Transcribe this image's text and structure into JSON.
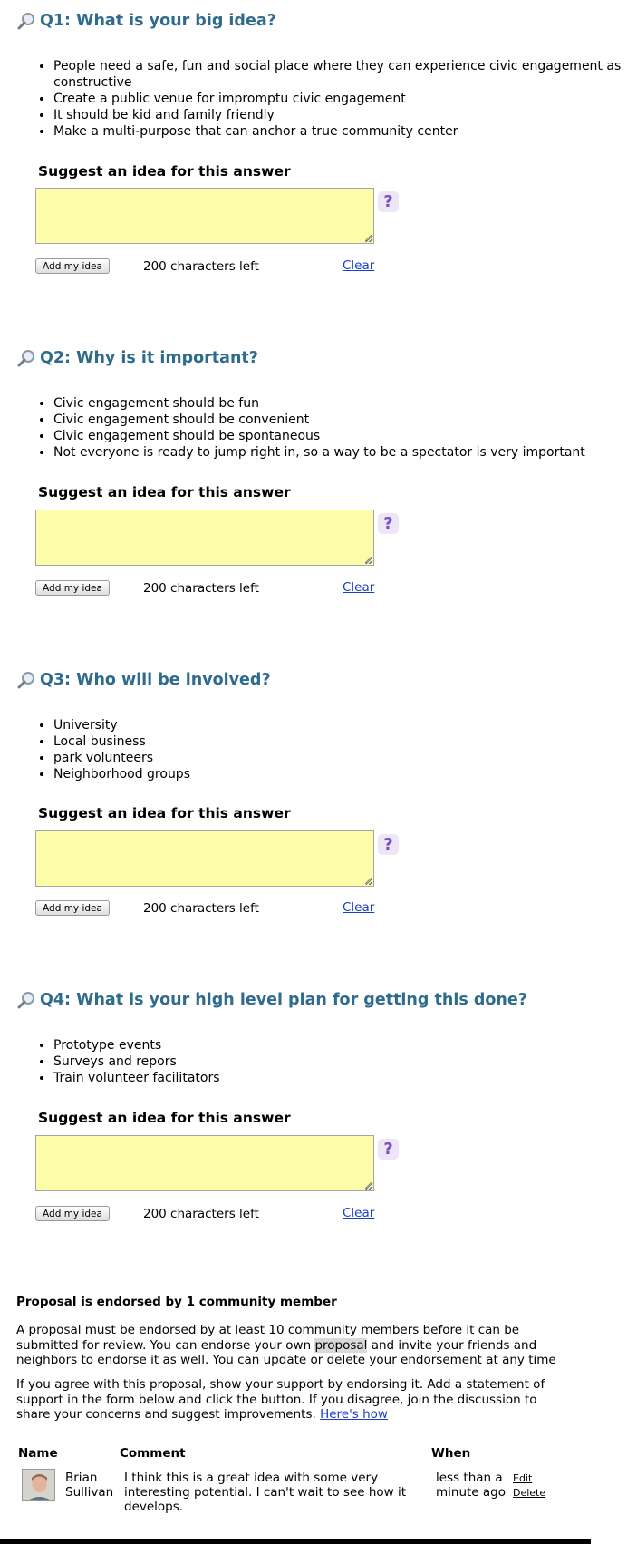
{
  "questions": [
    {
      "title": "Q1: What is your big idea?",
      "answers": [
        "People need a safe, fun and social place where they can experience civic engagement as constructive",
        "Create a public venue for impromptu civic engagement",
        "It should be kid and family friendly",
        "Make a multi-purpose that can anchor a true community center"
      ]
    },
    {
      "title": "Q2: Why is it important?",
      "answers": [
        "Civic engagement should be fun",
        "Civic engagement should be convenient",
        "Civic engagement should be spontaneous",
        "Not everyone is ready to jump right in, so a way to be a spectator is very important"
      ]
    },
    {
      "title": "Q3: Who will be involved?",
      "answers": [
        "University",
        "Local business",
        "park volunteers",
        "Neighborhood groups"
      ]
    },
    {
      "title": "Q4: What is your high level plan for getting this done?",
      "answers": [
        "Prototype events",
        "Surveys and repors",
        "Train volunteer facilitators"
      ]
    }
  ],
  "suggest_form": {
    "label": "Suggest an idea for this answer",
    "value": "",
    "help_glyph": "?",
    "add_button": "Add my idea",
    "chars_left": "200 characters left",
    "clear_link": "Clear"
  },
  "endorsement": {
    "title": "Proposal is endorsed by 1 community member",
    "para1_before": "A proposal must be endorsed by at least 10 community members before it can be submitted for review. You can endorse your own ",
    "para1_highlight": "proposal",
    "para1_after": " and invite your friends and neighbors to endorse it as well. You can update or delete your endorsement at any time",
    "para2": "If you agree with this proposal, show your support by endorsing it. Add a statement of support in the form below and click the button. If you disagree, join the discussion to share your concerns and suggest improvements. ",
    "para2_link": "Here's how"
  },
  "endorsements_table": {
    "headers": {
      "name": "Name",
      "comment": "Comment",
      "when": "When"
    },
    "rows": [
      {
        "name": "Brian Sullivan",
        "comment": "I think this is a great idea with some very interesting potential. I can't wait to see how it develops.",
        "when": "less than a minute ago",
        "edit": "Edit",
        "delete": "Delete"
      }
    ]
  },
  "colors": {
    "question_title": "#2f6b8c",
    "idea_box_bg": "#fdfca8",
    "help_icon": "#7f4fc2",
    "link": "#1a3ec8"
  }
}
